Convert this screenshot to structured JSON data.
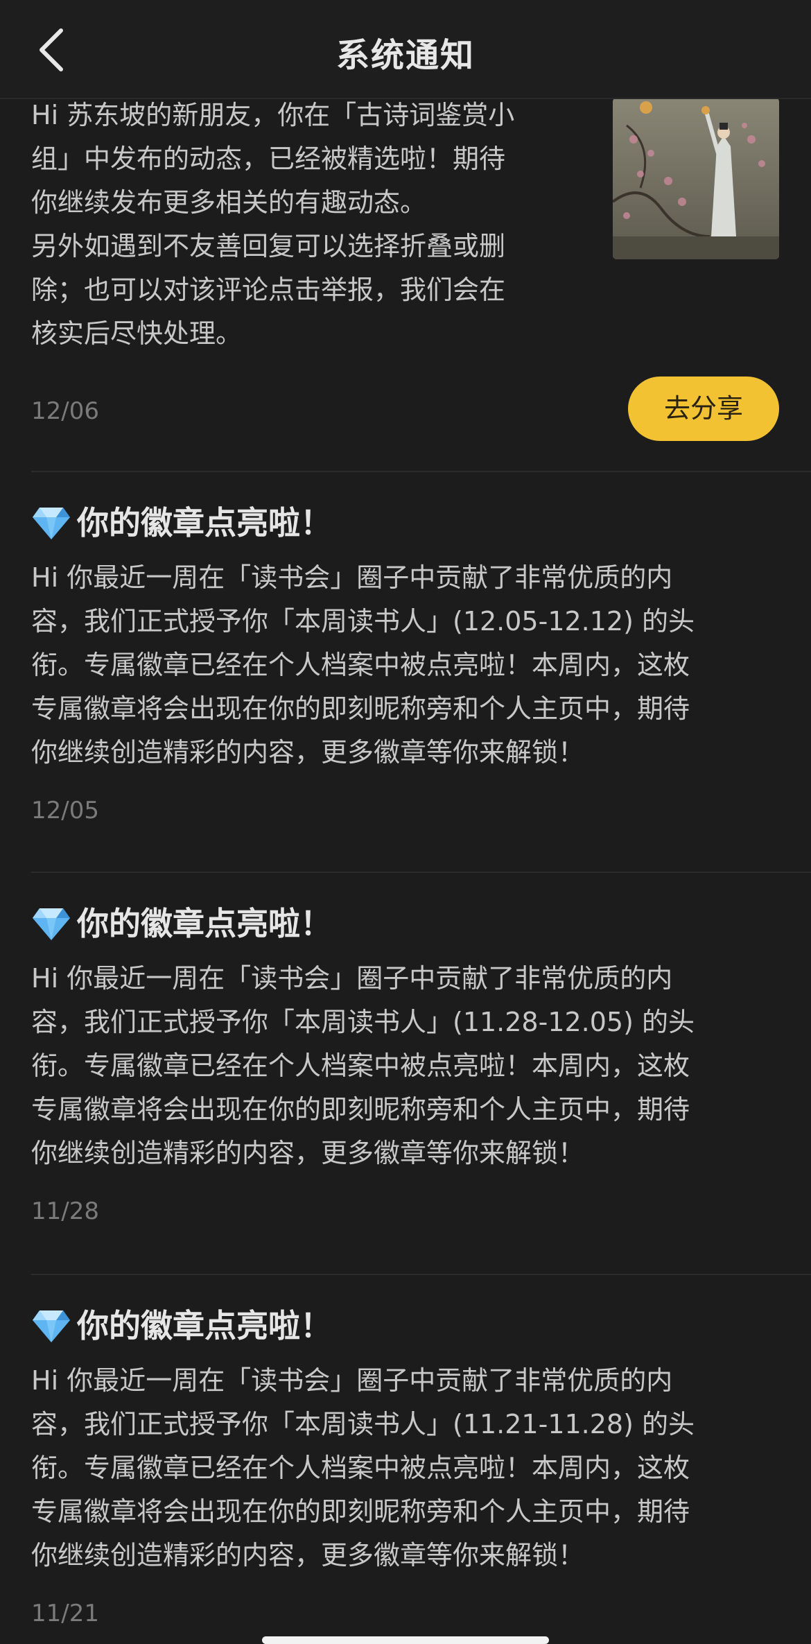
{
  "header": {
    "title": "系统通知"
  },
  "notices": [
    {
      "body_lines": [
        "Hi 苏东坡的新朋友，你在「古诗词鉴赏小",
        "组」中发布的动态，已经被精选啦！期待",
        "你继续发布更多相关的有趣动态。",
        "另外如遇到不友善回复可以选择折叠或删",
        "除；也可以对该评论点击举报，我们会在",
        "核实后尽快处理。"
      ],
      "date": "12/06",
      "share_label": "去分享",
      "thumbnail_icon": "poet-painting-image"
    },
    {
      "title": "你的徽章点亮啦！",
      "body_lines": [
        "Hi 你最近一周在「读书会」圈子中贡献了非常优质的内",
        "容，我们正式授予你「本周读书人」(12.05-12.12) 的头",
        "衔。专属徽章已经在个人档案中被点亮啦！本周内，这枚",
        "专属徽章将会出现在你的即刻昵称旁和个人主页中，期待",
        "你继续创造精彩的内容，更多徽章等你来解锁！"
      ],
      "date": "12/05",
      "icon": "gem-icon"
    },
    {
      "title": "你的徽章点亮啦！",
      "body_lines": [
        "Hi 你最近一周在「读书会」圈子中贡献了非常优质的内",
        "容，我们正式授予你「本周读书人」(11.28-12.05) 的头",
        "衔。专属徽章已经在个人档案中被点亮啦！本周内，这枚",
        "专属徽章将会出现在你的即刻昵称旁和个人主页中，期待",
        "你继续创造精彩的内容，更多徽章等你来解锁！"
      ],
      "date": "11/28",
      "icon": "gem-icon"
    },
    {
      "title": "你的徽章点亮啦！",
      "body_lines": [
        "Hi 你最近一周在「读书会」圈子中贡献了非常优质的内",
        "容，我们正式授予你「本周读书人」(11.21-11.28) 的头",
        "衔。专属徽章已经在个人档案中被点亮啦！本周内，这枚",
        "专属徽章将会出现在你的即刻昵称旁和个人主页中，期待",
        "你继续创造精彩的内容，更多徽章等你来解锁！"
      ],
      "date": "11/21",
      "icon": "gem-icon"
    }
  ],
  "colors": {
    "background": "#1c1c1c",
    "accent": "#f2c232",
    "text": "#c8c8c8",
    "date": "#7b7b7b"
  }
}
